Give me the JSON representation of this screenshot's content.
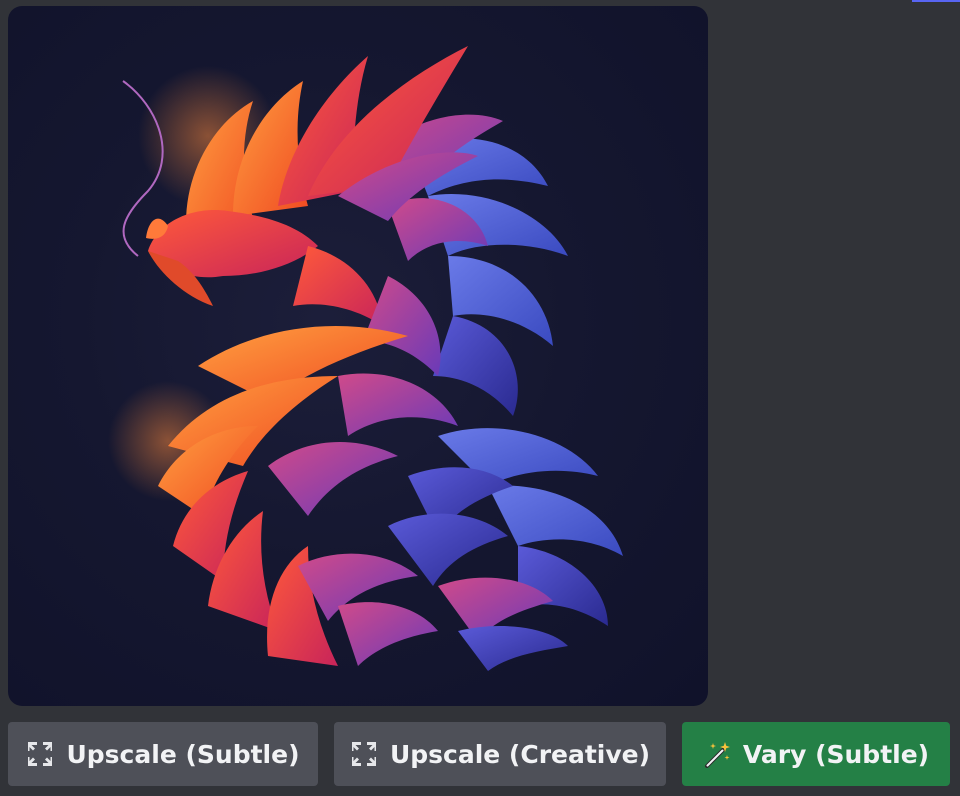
{
  "image": {
    "description_name": "dragon-artwork"
  },
  "buttons": [
    {
      "label": "Upscale (Subtle)",
      "icon": "expand-arrows-icon",
      "style": "secondary"
    },
    {
      "label": "Upscale (Creative)",
      "icon": "expand-arrows-icon",
      "style": "secondary"
    },
    {
      "label": "Vary (Subtle)",
      "icon": "magic-wand-icon",
      "style": "success"
    }
  ],
  "colors": {
    "background": "#313338",
    "secondary_button": "#4e5058",
    "success_button": "#248046",
    "accent": "#5865f2"
  }
}
